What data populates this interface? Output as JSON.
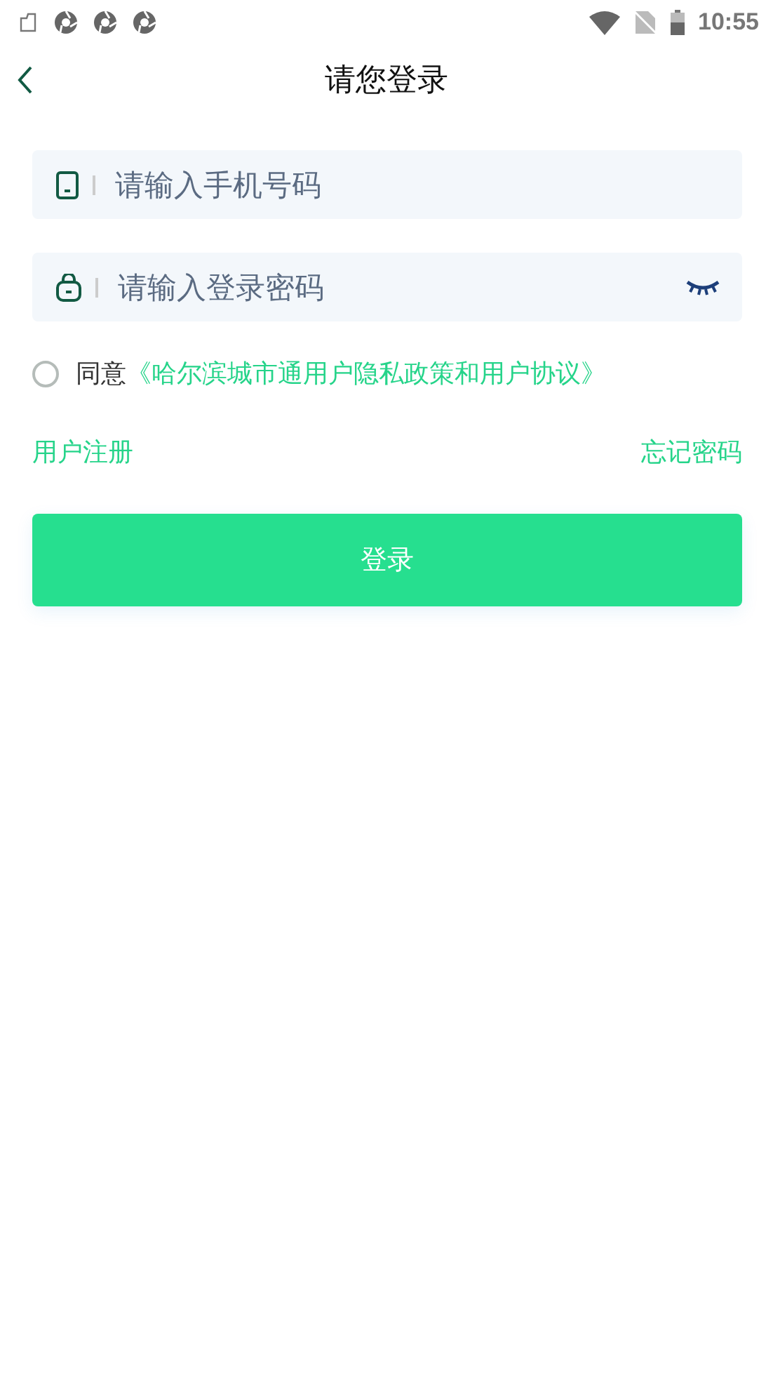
{
  "status_bar": {
    "time": "10:55"
  },
  "header": {
    "title": "请您登录"
  },
  "fields": [
    {
      "kind": "phone",
      "placeholder": "请输入手机号码"
    },
    {
      "kind": "password",
      "placeholder": "请输入登录密码"
    }
  ],
  "agreement": {
    "checked": false,
    "prefix": "同意",
    "link": "《哈尔滨城市通用户隐私政策和用户协议》"
  },
  "links": {
    "register": "用户注册",
    "forgot": "忘记密码"
  },
  "login_button": "登录"
}
